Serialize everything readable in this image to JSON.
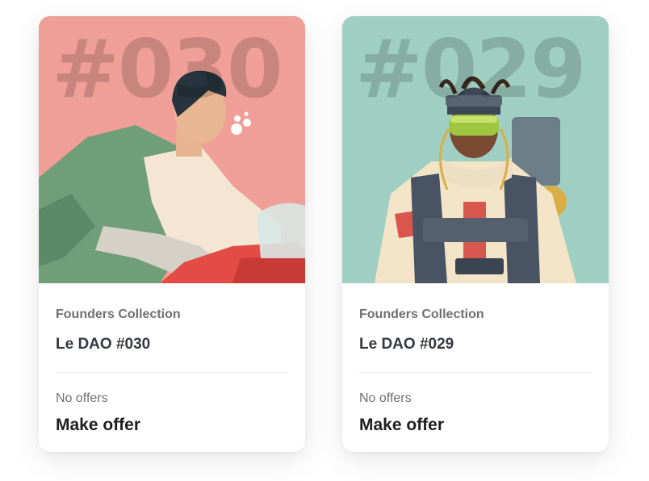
{
  "cards": [
    {
      "art_number": "#030",
      "art_bg": "#ef9f97",
      "collection": "Founders Collection",
      "name": "Le DAO #030",
      "offers_text": "No offers",
      "action_label": "Make offer"
    },
    {
      "art_number": "#029",
      "art_bg": "#9fcfc2",
      "collection": "Founders Collection",
      "name": "Le DAO #029",
      "offers_text": "No offers",
      "action_label": "Make offer"
    }
  ]
}
